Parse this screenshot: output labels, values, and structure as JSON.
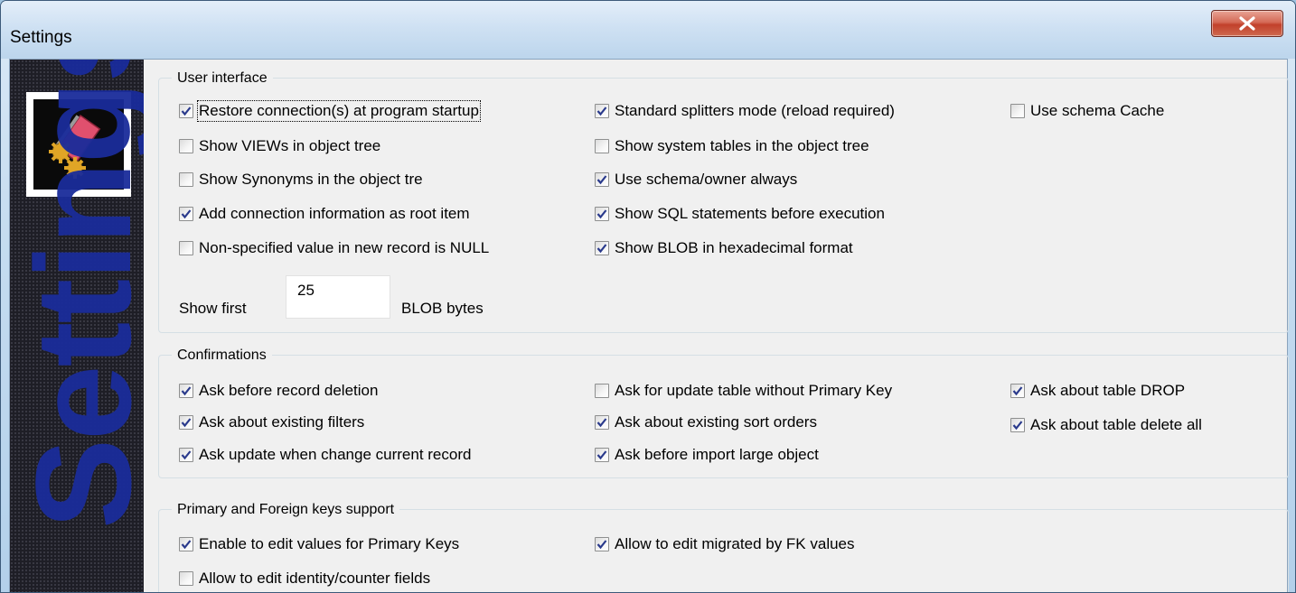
{
  "window": {
    "title": "Settings"
  },
  "sidebar": {
    "banner_text": "Settings"
  },
  "groups": {
    "user_interface": {
      "legend": "User interface",
      "options": [
        {
          "label": "Restore connection(s) at program startup",
          "checked": true
        },
        {
          "label": "Standard splitters mode (reload required)",
          "checked": true
        },
        {
          "label": "Use schema Cache",
          "checked": false
        },
        {
          "label": "Show VIEWs in object tree",
          "checked": false
        },
        {
          "label": "Show system tables in the object tree",
          "checked": false
        },
        {
          "label": "Show Synonyms in the object tre",
          "checked": false
        },
        {
          "label": "Use schema/owner always",
          "checked": true
        },
        {
          "label": "Add connection information as root item",
          "checked": true
        },
        {
          "label": "Show SQL statements before execution",
          "checked": true
        },
        {
          "label": "Non-specified value in new record is NULL",
          "checked": false
        },
        {
          "label": "Show BLOB in hexadecimal format",
          "checked": true
        }
      ],
      "show_first_label": "Show first",
      "show_first_value": "25",
      "blob_bytes_label": "BLOB bytes"
    },
    "confirmations": {
      "legend": "Confirmations",
      "options": [
        {
          "label": "Ask before record deletion",
          "checked": true
        },
        {
          "label": "Ask for update table without Primary Key",
          "checked": false
        },
        {
          "label": "Ask about table DROP",
          "checked": true
        },
        {
          "label": "Ask about existing filters",
          "checked": true
        },
        {
          "label": "Ask about existing sort orders",
          "checked": true
        },
        {
          "label": "Ask about table delete all",
          "checked": true
        },
        {
          "label": "Ask update when change current record",
          "checked": true
        },
        {
          "label": "Ask before import large object",
          "checked": true
        }
      ]
    },
    "keys_support": {
      "legend": "Primary and Foreign keys support",
      "options": [
        {
          "label": "Enable to edit values for Primary Keys",
          "checked": true
        },
        {
          "label": "Allow to edit migrated by FK values",
          "checked": true
        },
        {
          "label": "Allow to edit identity/counter fields",
          "checked": false
        }
      ]
    }
  },
  "icons": {
    "close": "close-icon",
    "logo": "settings-gears-book-icon",
    "check": "checkmark-icon"
  },
  "colors": {
    "check": "#2a3a8c",
    "sidebar_text": "#1a2c9a",
    "close_button": "#c2402b"
  }
}
